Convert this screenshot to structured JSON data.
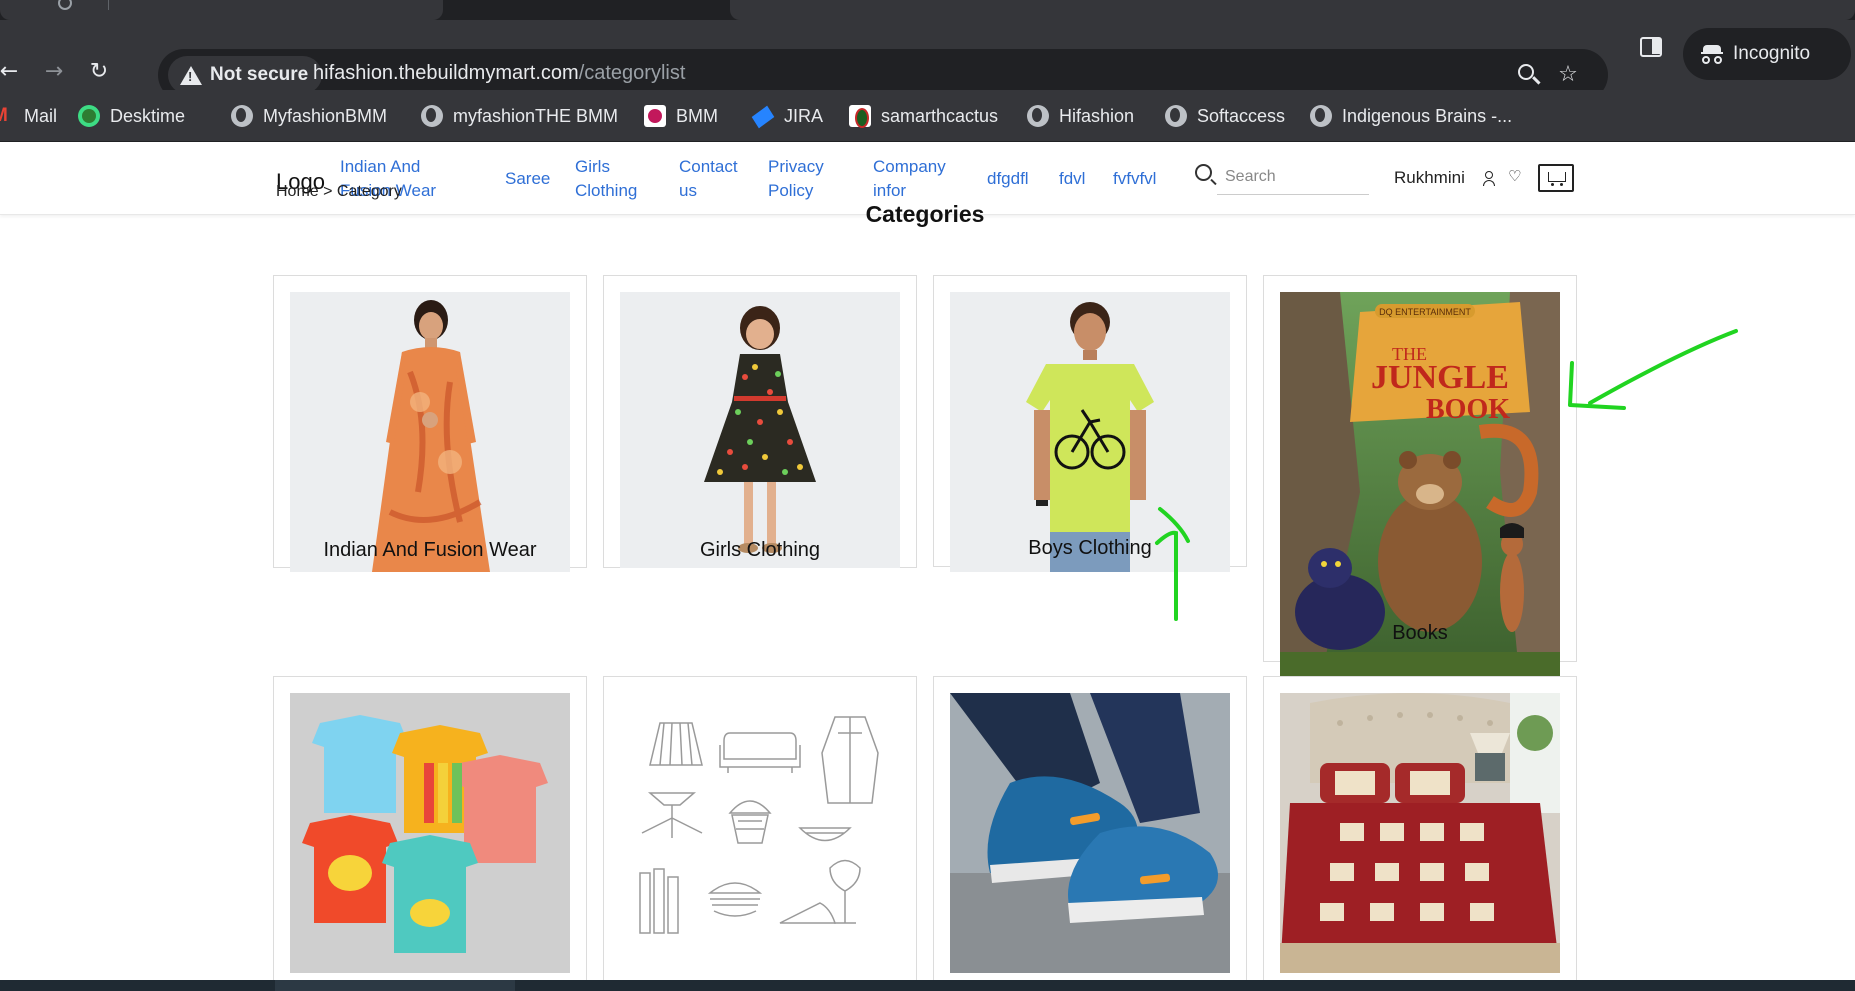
{
  "browser": {
    "security_label": "Not secure",
    "url_host": "hifashion.thebuildmymart.com",
    "url_path": "/categorylist",
    "incognito_label": "Incognito",
    "bookmarks": [
      {
        "label": "Mail",
        "icon": "gmail-icon"
      },
      {
        "label": "Desktime",
        "icon": "desktime-icon"
      },
      {
        "label": "MyfashionBMM",
        "icon": "globe-icon"
      },
      {
        "label": "myfashionTHE BMM",
        "icon": "globe-icon"
      },
      {
        "label": "BMM",
        "icon": "bmm-icon"
      },
      {
        "label": "JIRA",
        "icon": "jira-icon"
      },
      {
        "label": "samarthcactus",
        "icon": "cactus-icon"
      },
      {
        "label": "Hifashion",
        "icon": "globe-icon"
      },
      {
        "label": "Softaccess",
        "icon": "globe-icon"
      },
      {
        "label": "Indigenous Brains -...",
        "icon": "globe-icon"
      }
    ]
  },
  "site": {
    "logo": "Logo",
    "nav": [
      {
        "line1": "Indian And",
        "line2": "Fusion Wear"
      },
      {
        "line1": "Saree",
        "line2": ""
      },
      {
        "line1": "Girls",
        "line2": "Clothing"
      },
      {
        "line1": "Contact",
        "line2": "us"
      },
      {
        "line1": "Privacy",
        "line2": "Policy"
      },
      {
        "line1": "Company",
        "line2": "infor"
      },
      {
        "line1": "dfgdfl",
        "line2": ""
      },
      {
        "line1": "fdvl",
        "line2": ""
      },
      {
        "line1": "fvfvfvl",
        "line2": ""
      }
    ],
    "search_placeholder": "Search",
    "user_name": "Rukhmini",
    "breadcrumb": "Home > Category",
    "page_title": "Categories"
  },
  "categories": [
    {
      "name": "Indian And Fusion Wear",
      "image": "woman-in-orange-kurta"
    },
    {
      "name": "Girls Clothing",
      "image": "girl-in-floral-dress"
    },
    {
      "name": "Boys Clothing",
      "image": "boy-in-lime-tshirt"
    },
    {
      "name": "Books",
      "image": "jungle-book-cover"
    },
    {
      "name": "",
      "image": "kids-tshirts"
    },
    {
      "name": "",
      "image": "line-art-household-items"
    },
    {
      "name": "",
      "image": "blue-sneakers"
    },
    {
      "name": "",
      "image": "bedsheet-bedroom"
    }
  ],
  "book_cover_text": {
    "publisher": "DQ ENTERTAINMENT",
    "the": "THE",
    "title": "JUNGLE",
    "title2": "BOOK"
  },
  "colors": {
    "link": "#2f6fd6",
    "annotation": "#21d421",
    "chrome": "#35363a"
  }
}
